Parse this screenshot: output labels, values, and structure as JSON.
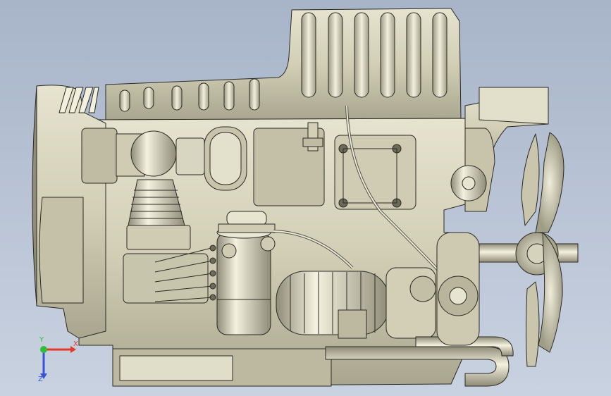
{
  "viewport": {
    "background_top": "#a8b4c8",
    "background_bottom": "#c9d2e0",
    "model": {
      "name": "engine-assembly",
      "body_color": "#d6d3bc",
      "shadow_color": "#9e9b86",
      "edge_color": "#2a2a24"
    }
  },
  "triad": {
    "x_label": "X",
    "y_label": "Y",
    "z_label": "Z",
    "x_color": "#e23a2a",
    "y_color": "#2fbf3a",
    "z_color": "#3a52d8"
  }
}
